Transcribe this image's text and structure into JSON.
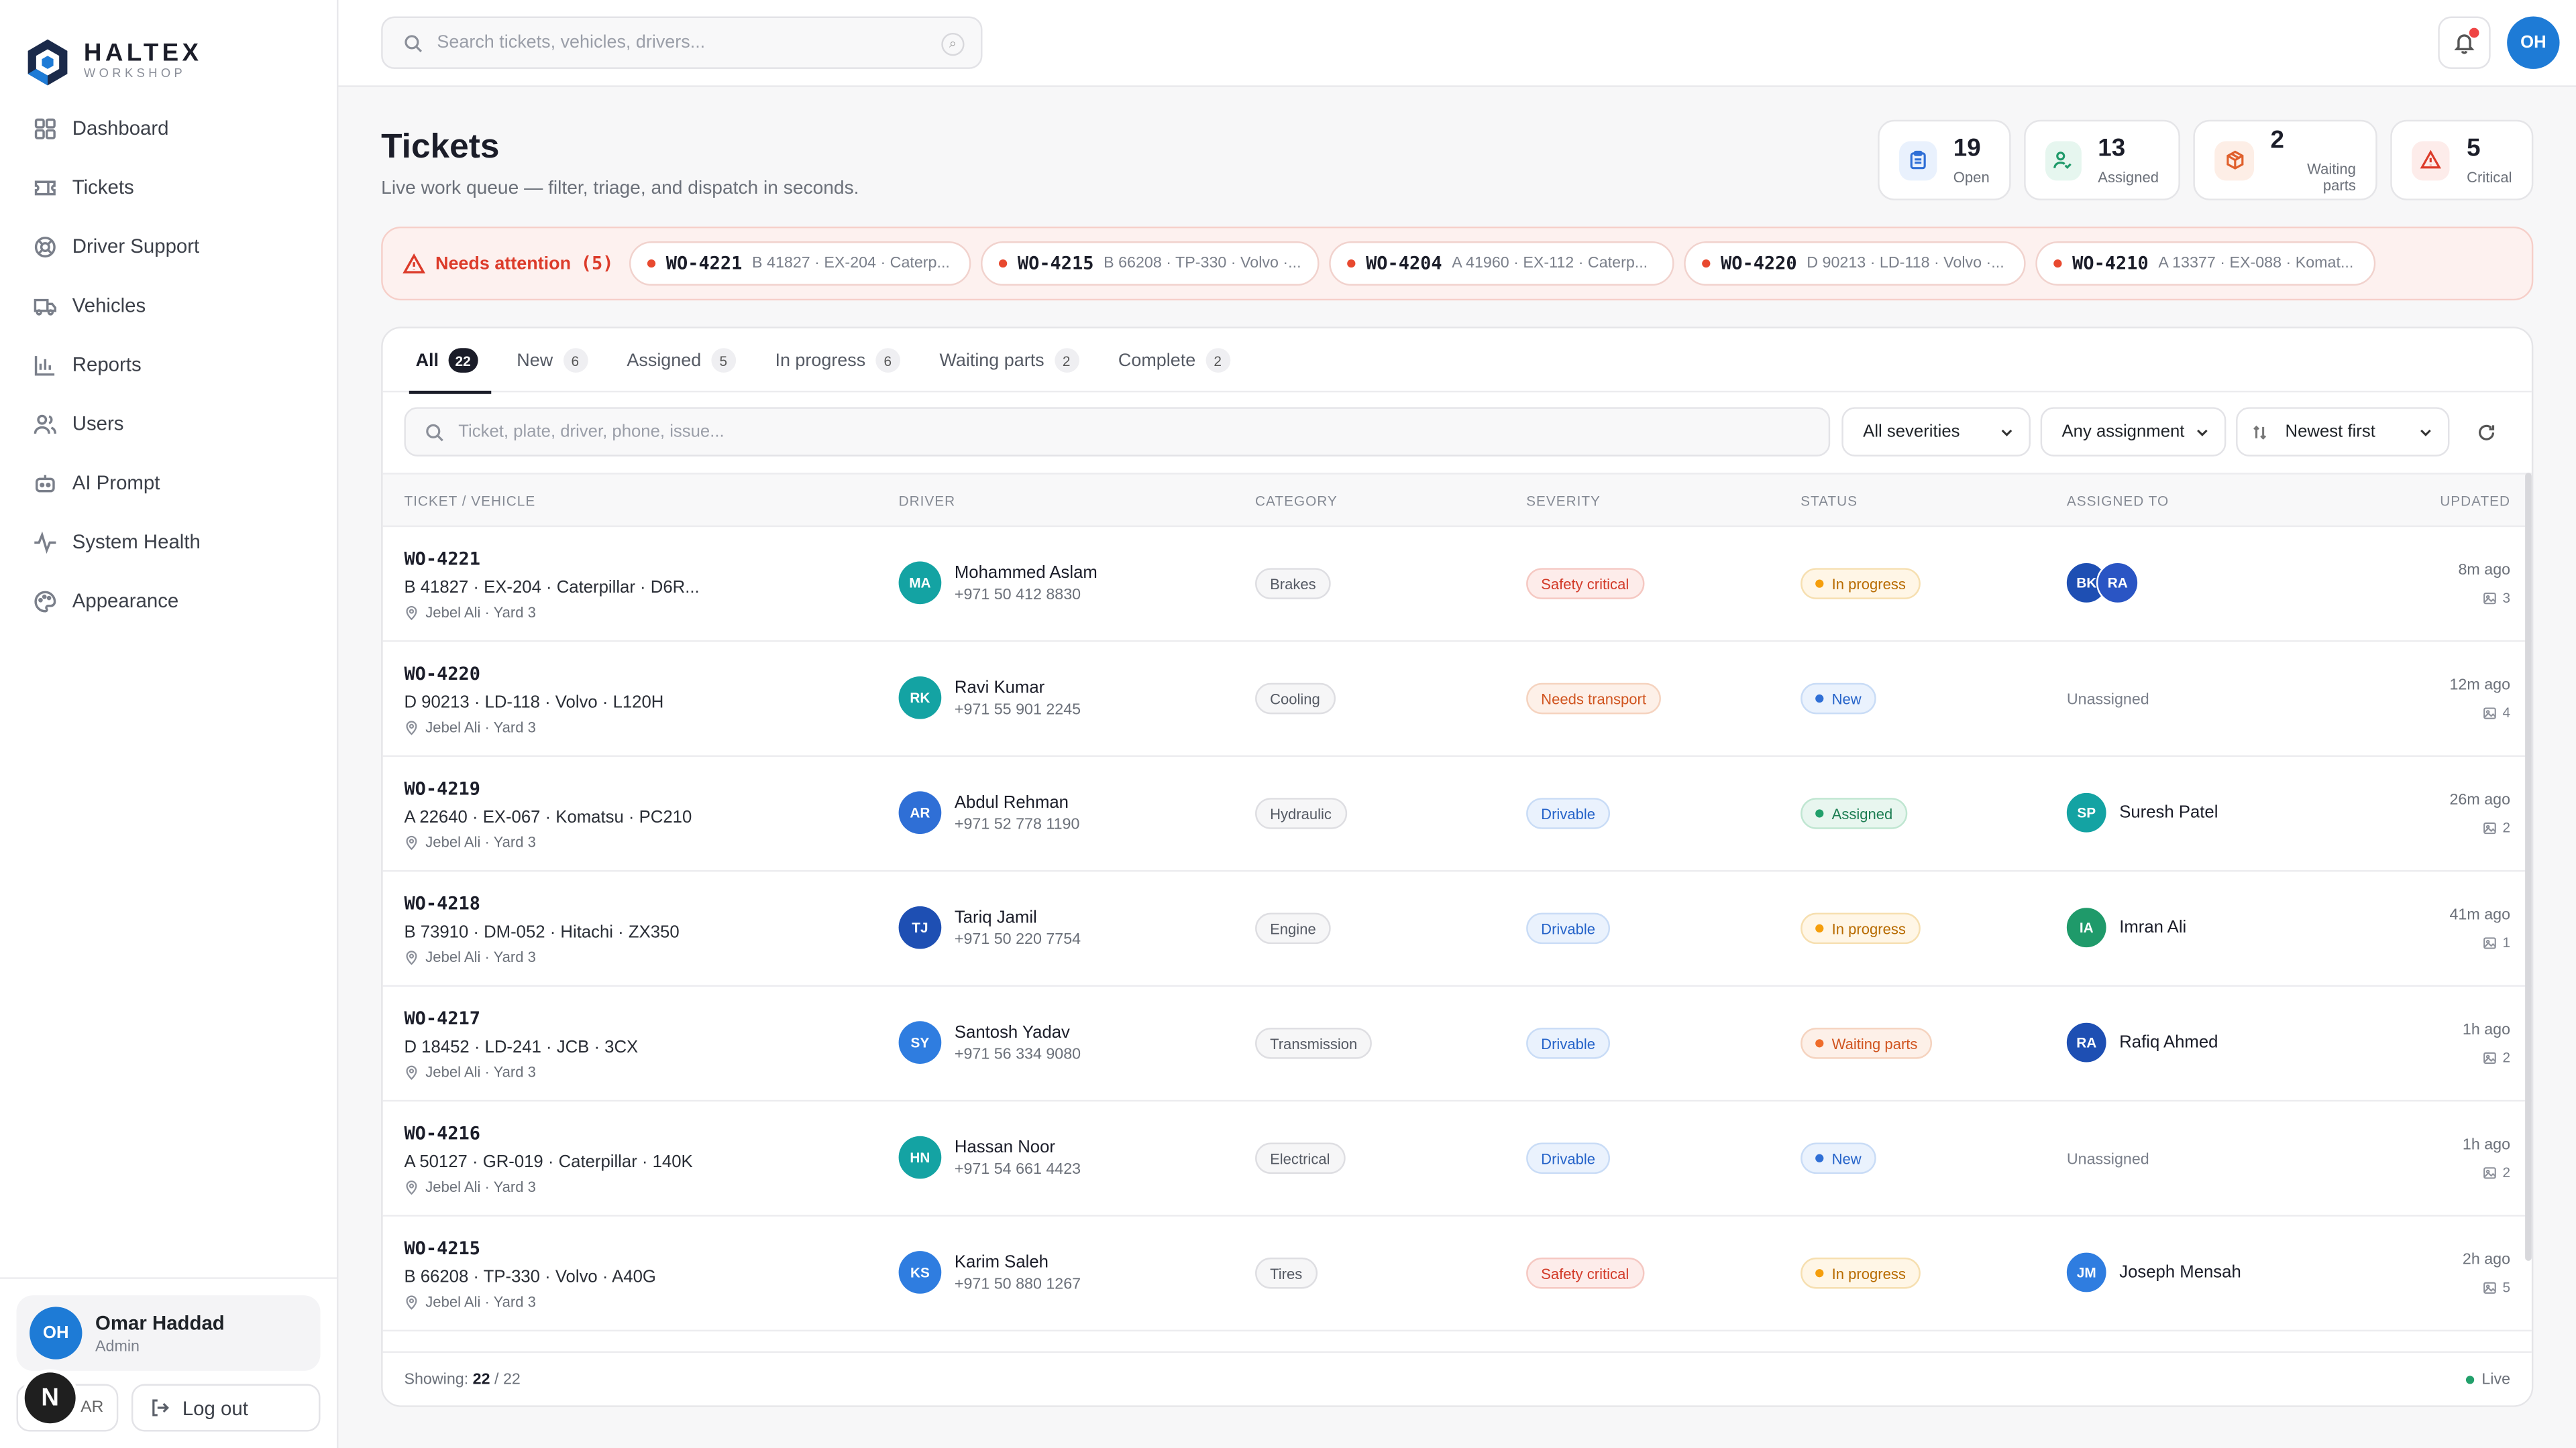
{
  "brand": {
    "name": "HALTEX",
    "sub": "WORKSHOP",
    "accent": "#1e7bd6"
  },
  "nav": [
    {
      "label": "Dashboard",
      "icon": "grid-icon"
    },
    {
      "label": "Tickets",
      "icon": "ticket-icon"
    },
    {
      "label": "Driver Support",
      "icon": "lifebuoy-icon"
    },
    {
      "label": "Vehicles",
      "icon": "truck-icon"
    },
    {
      "label": "Reports",
      "icon": "bar-chart-icon"
    },
    {
      "label": "Users",
      "icon": "users-icon"
    },
    {
      "label": "AI Prompt",
      "icon": "robot-icon"
    },
    {
      "label": "System Health",
      "icon": "pulse-icon"
    },
    {
      "label": "Appearance",
      "icon": "palette-icon"
    }
  ],
  "user": {
    "initials": "OH",
    "name": "Omar Haddad",
    "role": "Admin",
    "lang": "AR",
    "logout": "Log out",
    "badge": "N"
  },
  "topbar": {
    "search_placeholder": "Search tickets, vehicles, drivers...",
    "avatar": "OH"
  },
  "page": {
    "title": "Tickets",
    "subtitle": "Live work queue — filter, triage, and dispatch in seconds."
  },
  "stats": [
    {
      "value": "19",
      "label": "Open",
      "icon": "clipboard-icon",
      "color": "#2f6fd6",
      "bg": "#e9f1fd"
    },
    {
      "value": "13",
      "label": "Assigned",
      "icon": "user-check-icon",
      "color": "#1f9a6a",
      "bg": "#e6f6ef"
    },
    {
      "value": "2",
      "label": "Waiting parts",
      "icon": "package-icon",
      "color": "#e0602c",
      "bg": "#fdeee6"
    },
    {
      "value": "5",
      "label": "Critical",
      "icon": "alert-icon",
      "color": "#dc3b2a",
      "bg": "#fdecea"
    }
  ],
  "attention": {
    "label": "Needs attention",
    "count": "(5)",
    "items": [
      {
        "id": "WO-4221",
        "desc": "B 41827 · EX-204 · Caterp..."
      },
      {
        "id": "WO-4215",
        "desc": "B 66208 · TP-330 · Volvo ·..."
      },
      {
        "id": "WO-4204",
        "desc": "A 41960 · EX-112 · Caterp..."
      },
      {
        "id": "WO-4220",
        "desc": "D 90213 · LD-118 · Volvo ·..."
      },
      {
        "id": "WO-4210",
        "desc": "A 13377 · EX-088 · Komat..."
      }
    ]
  },
  "tabs": [
    {
      "label": "All",
      "count": "22"
    },
    {
      "label": "New",
      "count": "6"
    },
    {
      "label": "Assigned",
      "count": "5"
    },
    {
      "label": "In progress",
      "count": "6"
    },
    {
      "label": "Waiting parts",
      "count": "2"
    },
    {
      "label": "Complete",
      "count": "2"
    }
  ],
  "filters": {
    "search_placeholder": "Ticket, plate, driver, phone, issue...",
    "severity": "All severities",
    "assignment": "Any assignment",
    "sort": "Newest first"
  },
  "columns": [
    "TICKET / VEHICLE",
    "DRIVER",
    "CATEGORY",
    "SEVERITY",
    "STATUS",
    "ASSIGNED TO",
    "UPDATED"
  ],
  "severity_styles": {
    "Safety critical": {
      "bg": "#fdecea",
      "border": "#f5c8c2",
      "color": "#d23a28"
    },
    "Needs transport": {
      "bg": "#fdf0e8",
      "border": "#f5d3bf",
      "color": "#d0541f"
    },
    "Drivable": {
      "bg": "#eaf2fd",
      "border": "#c9dcf6",
      "color": "#2563c9"
    }
  },
  "status_styles": {
    "In progress": {
      "bg": "#fff6e6",
      "border": "#f6dfb0",
      "color": "#b86b00",
      "dot": "#f59e0b"
    },
    "New": {
      "bg": "#eaf2fd",
      "border": "#c9dcf6",
      "color": "#2563c9",
      "dot": "#2f6fd6"
    },
    "Assigned": {
      "bg": "#e8f6ef",
      "border": "#bfe6d1",
      "color": "#1c7d52",
      "dot": "#22a06b"
    },
    "Waiting parts": {
      "bg": "#fdf0e8",
      "border": "#f5d3bf",
      "color": "#d0541f",
      "dot": "#ef6c2a"
    }
  },
  "rows": [
    {
      "id": "WO-4221",
      "vehicle": "B 41827 · EX-204 · Caterpillar · D6R...",
      "location": "Jebel Ali · Yard 3",
      "driver": {
        "initials": "MA",
        "name": "Mohammed Aslam",
        "phone": "+971 50 412 8830",
        "color": "#14a3a3"
      },
      "category": "Brakes",
      "severity": "Safety critical",
      "status": "In progress",
      "assigned": {
        "type": "multi",
        "avatars": [
          {
            "initials": "BK",
            "color": "#1e4fb3"
          },
          {
            "initials": "RA",
            "color": "#2a55c4"
          }
        ]
      },
      "updated": "8m ago",
      "photos": "3"
    },
    {
      "id": "WO-4220",
      "vehicle": "D 90213 · LD-118 · Volvo · L120H",
      "location": "Jebel Ali · Yard 3",
      "driver": {
        "initials": "RK",
        "name": "Ravi Kumar",
        "phone": "+971 55 901 2245",
        "color": "#14a3a3"
      },
      "category": "Cooling",
      "severity": "Needs transport",
      "status": "New",
      "assigned": {
        "type": "none",
        "text": "Unassigned"
      },
      "updated": "12m ago",
      "photos": "4"
    },
    {
      "id": "WO-4219",
      "vehicle": "A 22640 · EX-067 · Komatsu · PC210",
      "location": "Jebel Ali · Yard 3",
      "driver": {
        "initials": "AR",
        "name": "Abdul Rehman",
        "phone": "+971 52 778 1190",
        "color": "#2f6fd6"
      },
      "category": "Hydraulic",
      "severity": "Drivable",
      "status": "Assigned",
      "assigned": {
        "type": "one",
        "initials": "SP",
        "name": "Suresh Patel",
        "color": "#14a3a3"
      },
      "updated": "26m ago",
      "photos": "2"
    },
    {
      "id": "WO-4218",
      "vehicle": "B 73910 · DM-052 · Hitachi · ZX350",
      "location": "Jebel Ali · Yard 3",
      "driver": {
        "initials": "TJ",
        "name": "Tariq Jamil",
        "phone": "+971 50 220 7754",
        "color": "#1e4fb3"
      },
      "category": "Engine",
      "severity": "Drivable",
      "status": "In progress",
      "assigned": {
        "type": "one",
        "initials": "IA",
        "name": "Imran Ali",
        "color": "#1f9a6a"
      },
      "updated": "41m ago",
      "photos": "1"
    },
    {
      "id": "WO-4217",
      "vehicle": "D 18452 · LD-241 · JCB · 3CX",
      "location": "Jebel Ali · Yard 3",
      "driver": {
        "initials": "SY",
        "name": "Santosh Yadav",
        "phone": "+971 56 334 9080",
        "color": "#2f7de0"
      },
      "category": "Transmission",
      "severity": "Drivable",
      "status": "Waiting parts",
      "assigned": {
        "type": "one",
        "initials": "RA",
        "name": "Rafiq Ahmed",
        "color": "#1e4fb3"
      },
      "updated": "1h ago",
      "photos": "2"
    },
    {
      "id": "WO-4216",
      "vehicle": "A 50127 · GR-019 · Caterpillar · 140K",
      "location": "Jebel Ali · Yard 3",
      "driver": {
        "initials": "HN",
        "name": "Hassan Noor",
        "phone": "+971 54 661 4423",
        "color": "#14a3a3"
      },
      "category": "Electrical",
      "severity": "Drivable",
      "status": "New",
      "assigned": {
        "type": "none",
        "text": "Unassigned"
      },
      "updated": "1h ago",
      "photos": "2"
    },
    {
      "id": "WO-4215",
      "vehicle": "B 66208 · TP-330 · Volvo · A40G",
      "location": "Jebel Ali · Yard 3",
      "driver": {
        "initials": "KS",
        "name": "Karim Saleh",
        "phone": "+971 50 880 1267",
        "color": "#2f7de0"
      },
      "category": "Tires",
      "severity": "Safety critical",
      "status": "In progress",
      "assigned": {
        "type": "one",
        "initials": "JM",
        "name": "Joseph Mensah",
        "color": "#2f7de0"
      },
      "updated": "2h ago",
      "photos": "5"
    }
  ],
  "footer": {
    "showing_label": "Showing:",
    "shown": "22",
    "total": "/ 22",
    "live": "Live"
  }
}
